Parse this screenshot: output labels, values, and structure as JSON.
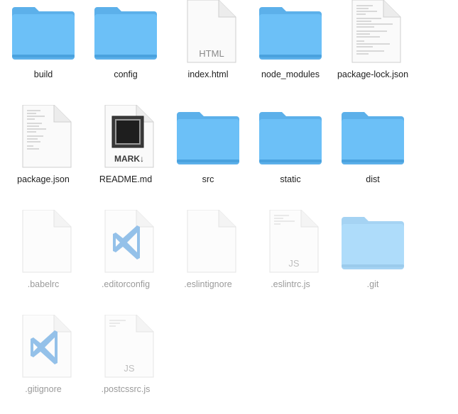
{
  "finder": {
    "items": [
      {
        "label": "build",
        "kind": "folder",
        "hidden": false
      },
      {
        "label": "config",
        "kind": "folder",
        "hidden": false
      },
      {
        "label": "index.html",
        "kind": "doc-html",
        "badge": "HTML",
        "hidden": false
      },
      {
        "label": "node_modules",
        "kind": "folder",
        "hidden": false
      },
      {
        "label": "package-lock.json",
        "kind": "doc-text",
        "hidden": false
      },
      {
        "label": "package.json",
        "kind": "doc-text",
        "hidden": false
      },
      {
        "label": "README.md",
        "kind": "doc-markdown",
        "badge": "MARK↓",
        "hidden": false
      },
      {
        "label": "src",
        "kind": "folder",
        "hidden": false
      },
      {
        "label": "static",
        "kind": "folder",
        "hidden": false
      },
      {
        "label": "dist",
        "kind": "folder",
        "hidden": false
      },
      {
        "label": ".babelrc",
        "kind": "doc-blank",
        "hidden": true
      },
      {
        "label": ".editorconfig",
        "kind": "doc-vscode",
        "hidden": true
      },
      {
        "label": ".eslintignore",
        "kind": "doc-blank",
        "hidden": true
      },
      {
        "label": ".eslintrc.js",
        "kind": "doc-js",
        "badge": "JS",
        "hidden": true
      },
      {
        "label": ".git",
        "kind": "folder",
        "hidden": true
      },
      {
        "label": ".gitignore",
        "kind": "doc-vscode",
        "hidden": true
      },
      {
        "label": ".postcssrc.js",
        "kind": "doc-js",
        "badge": "JS",
        "hidden": true
      }
    ]
  },
  "colors": {
    "folder_front": "#6cc0f7",
    "folder_back": "#5cb0ea",
    "vscode_blue": "#3d8fd8"
  }
}
